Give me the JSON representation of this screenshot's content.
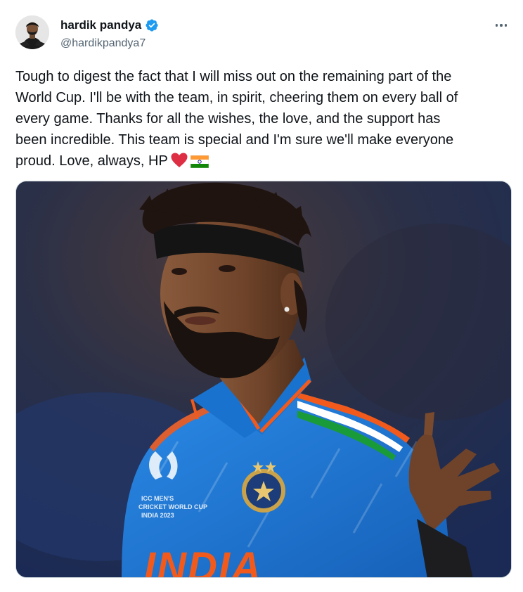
{
  "author": {
    "display_name": "hardik pandya",
    "handle": "@hardikpandya7",
    "verified": true,
    "verified_icon": "verified-badge-icon",
    "avatar_icon": "profile-avatar"
  },
  "more_icon": "more-options-icon",
  "tweet": {
    "lines": [
      "Tough to digest the fact that I will miss out on the remaining part of the",
      "World Cup. I'll be with the team, in spirit, cheering them on every ball of",
      "every game. Thanks for all the wishes, the love, and the support has",
      "been incredible. This team is special and I'm sure we'll make everyone",
      "proud. Love, always, HP"
    ],
    "emojis": [
      "red-heart-emoji",
      "india-flag-emoji"
    ]
  },
  "media": {
    "jersey_text": "INDIA",
    "wc_badge_lines": [
      "ICC MEN'S",
      "CRICKET WORLD CUP",
      "INDIA 2023"
    ]
  },
  "colors": {
    "verified_blue": "#1d9bf0",
    "text_primary": "#0f1419",
    "text_secondary": "#536471",
    "jersey_blue": "#1f7fd8",
    "jersey_orange": "#f25a1c"
  }
}
